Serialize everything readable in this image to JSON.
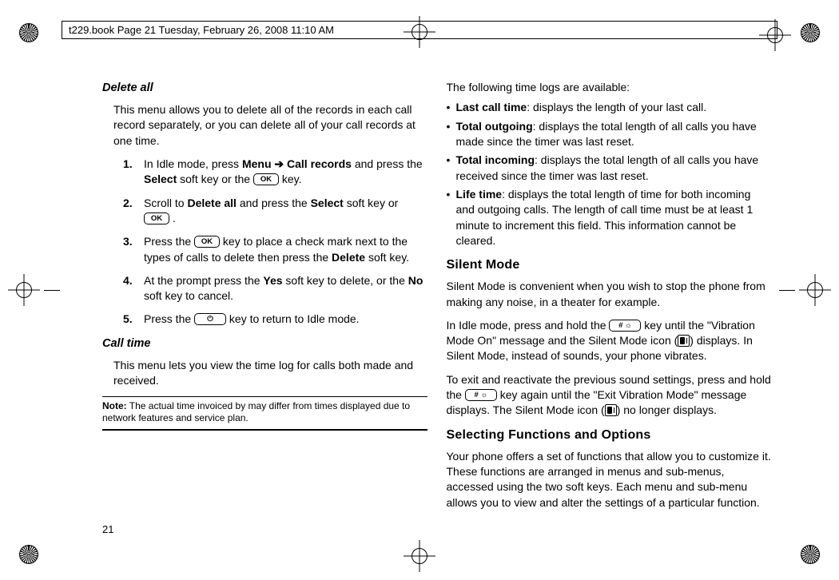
{
  "header": "t229.book  Page 21  Tuesday, February 26, 2008  11:10 AM",
  "page_number": "21",
  "left": {
    "subsection1": "Delete all",
    "p1": "This menu allows you to delete all of the records in each call record separately, or you can delete all of your call records at one time.",
    "steps": {
      "s1a": "In Idle mode, press ",
      "s1b": "Menu ➔ Call records",
      "s1c": " and press the ",
      "s1d": "Select",
      "s1e": " soft key or the ",
      "s1g": " key.",
      "s2a": "Scroll to ",
      "s2b": "Delete all",
      "s2c": " and press the ",
      "s2d": "Select",
      "s2e": " soft key or ",
      "s2g": " .",
      "s3a": "Press the ",
      "s3c": " key to place a check mark next to the types of calls to delete then press the ",
      "s3d": "Delete",
      "s3e": " soft key.",
      "s4a": "At the prompt press the ",
      "s4b": "Yes",
      "s4c": " soft key to delete, or the ",
      "s4d": "No",
      "s4e": " soft key to cancel.",
      "s5a": "Press the ",
      "s5c": " key to return to Idle mode."
    },
    "subsection2": "Call time",
    "p2": "This menu lets you view the time log for calls both made and received.",
    "note_label": "Note:",
    "note_text": " The actual time invoiced by may differ from times displayed due to network features and service plan."
  },
  "right": {
    "intro": "The following time logs are available:",
    "bullets": {
      "b1a": "Last call time",
      "b1b": ": displays the length of your last call.",
      "b2a": "Total outgoing",
      "b2b": ": displays the total length of all calls you have made since the timer was last reset.",
      "b3a": "Total incoming",
      "b3b": ": displays the total length of all calls you have received since the timer was last reset.",
      "b4a": "Life time",
      "b4b": ": displays the total length of time for both incoming and outgoing calls. The length of call time must be at least 1 minute to increment this field. This information cannot be cleared."
    },
    "section1": "Silent Mode",
    "sp1": "Silent Mode is convenient when you wish to stop the phone from making any noise, in a theater for example.",
    "sp2a": "In Idle mode, press and hold the ",
    "sp2b": " key until the \"Vibration Mode On\" message and the Silent Mode icon (",
    "sp2c": ") displays. In Silent Mode, instead of sounds, your phone vibrates.",
    "sp3a": "To exit and reactivate the previous sound settings, press and hold the ",
    "sp3b": " key again until the \"Exit Vibration Mode\" message displays. The Silent Mode icon (",
    "sp3c": ") no longer displays.",
    "section2": "Selecting Functions and Options",
    "sp4": "Your phone offers a set of functions that allow you to customize it. These functions are arranged in menus and sub-menus, accessed using the two soft keys. Each menu and sub-menu allows you to view and alter the settings of a particular function."
  },
  "keys": {
    "ok": "OK",
    "end": "⏻",
    "pound": "# ☼"
  }
}
